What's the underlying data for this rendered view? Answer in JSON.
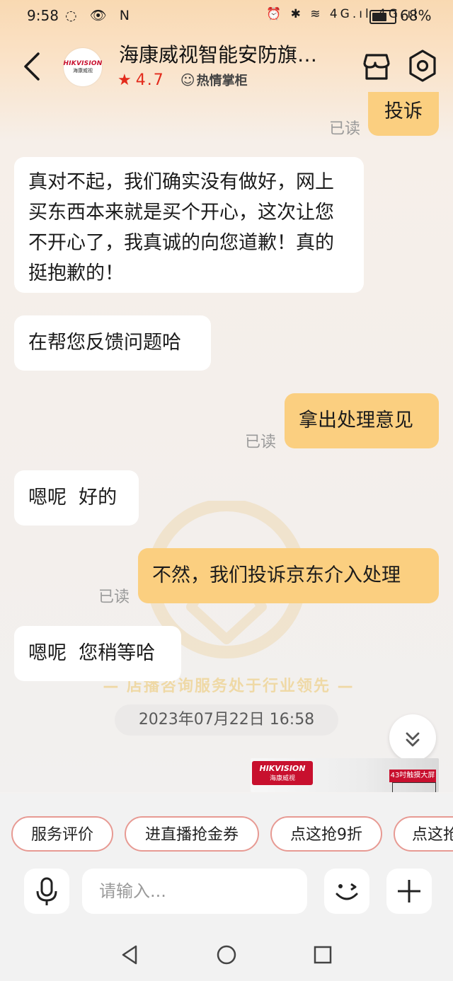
{
  "status_bar": {
    "time": "9:58",
    "left_icons": "◌ 👁 N",
    "right_icons": "⏰ ✱ ≋ 4G.ıl 4G.ıl",
    "battery": "68%"
  },
  "header": {
    "logo_line1": "HIKVISION",
    "logo_line2": "海康威视",
    "title": "海康威视智能安防旗…",
    "rating": "4.7",
    "tag": "热情掌柜"
  },
  "messages": [
    {
      "side": "right",
      "text": "投诉",
      "read": "已读"
    },
    {
      "side": "left",
      "text": "真对不起，我们确实没有做好，网上买东西本来就是买个开心，这次让您不开心了，我真诚的向您道歉！真的挺抱歉的！"
    },
    {
      "side": "left",
      "text": "在帮您反馈问题哈"
    },
    {
      "side": "right",
      "text": "拿出处理意见",
      "read": "已读"
    },
    {
      "side": "left",
      "text": "嗯呢  好的"
    },
    {
      "side": "right",
      "text": "不然，我们投诉京东介入处理",
      "read": "已读"
    },
    {
      "side": "left",
      "text": "嗯呢  您稍等哈"
    }
  ],
  "watermark_text": "— 店播咨询服务处于行业领先 —",
  "timestamp": "2023年07月22日  16:58",
  "banner": {
    "brand_line1": "HIKVISION",
    "brand_line2": "海康威视",
    "promo": "43吋触摸大屏"
  },
  "quick_replies": [
    "服务评价",
    "进直播抢金券",
    "点这抢9折",
    "点这抢"
  ],
  "input": {
    "placeholder": "请输入..."
  },
  "colors": {
    "accent": "#e32a1b",
    "bubble_right": "#fbcf80",
    "bubble_left": "#ffffff",
    "chip_border": "#e79a93"
  }
}
